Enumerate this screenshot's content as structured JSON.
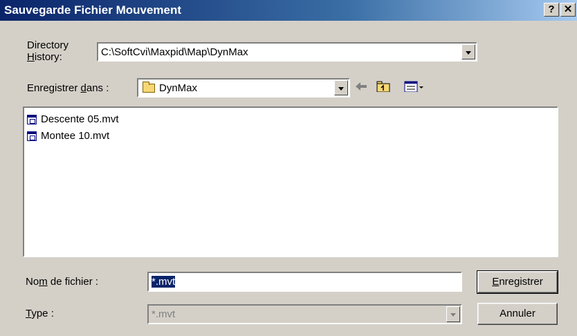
{
  "window": {
    "title": "Sauvegarde Fichier Mouvement",
    "help_label": "?",
    "close_label": "✕"
  },
  "history": {
    "label_line1": "Directory",
    "label_line2_prefix": "",
    "label_line2_ul": "H",
    "label_line2_rest": "istory:",
    "value": "C:\\SoftCvi\\Maxpid\\Map\\DynMax"
  },
  "savein": {
    "label_prefix": "Enregistrer ",
    "label_ul": "d",
    "label_rest": "ans :",
    "value": "DynMax"
  },
  "toolbar": {
    "back_icon": "back-arrow-icon",
    "up_icon": "up-folder-icon",
    "view_icon": "view-menu-icon"
  },
  "files": [
    {
      "name": "Descente 05.mvt",
      "icon": "mvt-file-icon"
    },
    {
      "name": "Montee 10.mvt",
      "icon": "mvt-file-icon"
    }
  ],
  "filename": {
    "label_prefix": "No",
    "label_ul": "m",
    "label_rest": " de fichier :",
    "value": "*.mvt"
  },
  "filetype": {
    "label_ul": "T",
    "label_rest": "ype :",
    "value": "*.mvt"
  },
  "buttons": {
    "save_ul": "E",
    "save_rest": "nregistrer",
    "cancel": "Annuler"
  },
  "colors": {
    "titlebar_start": "#0a246a",
    "titlebar_end": "#a6caf0",
    "face": "#d4d0c8"
  }
}
